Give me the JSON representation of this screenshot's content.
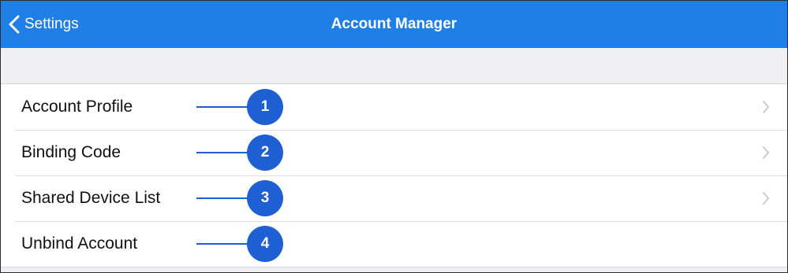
{
  "navbar": {
    "back_label": "Settings",
    "title": "Account Manager",
    "background_color": "#1f7fe6",
    "back_icon": "chevron-left-icon"
  },
  "rows": [
    {
      "label": "Account Profile",
      "callout": "1",
      "has_chevron": true
    },
    {
      "label": "Binding Code",
      "callout": "2",
      "has_chevron": true
    },
    {
      "label": "Shared Device List",
      "callout": "3",
      "has_chevron": true
    },
    {
      "label": "Unbind Account",
      "callout": "4",
      "has_chevron": false
    }
  ],
  "colors": {
    "callout": "#1e5fd4",
    "background": "#efeff4",
    "chevron": "#c7c7cc"
  }
}
